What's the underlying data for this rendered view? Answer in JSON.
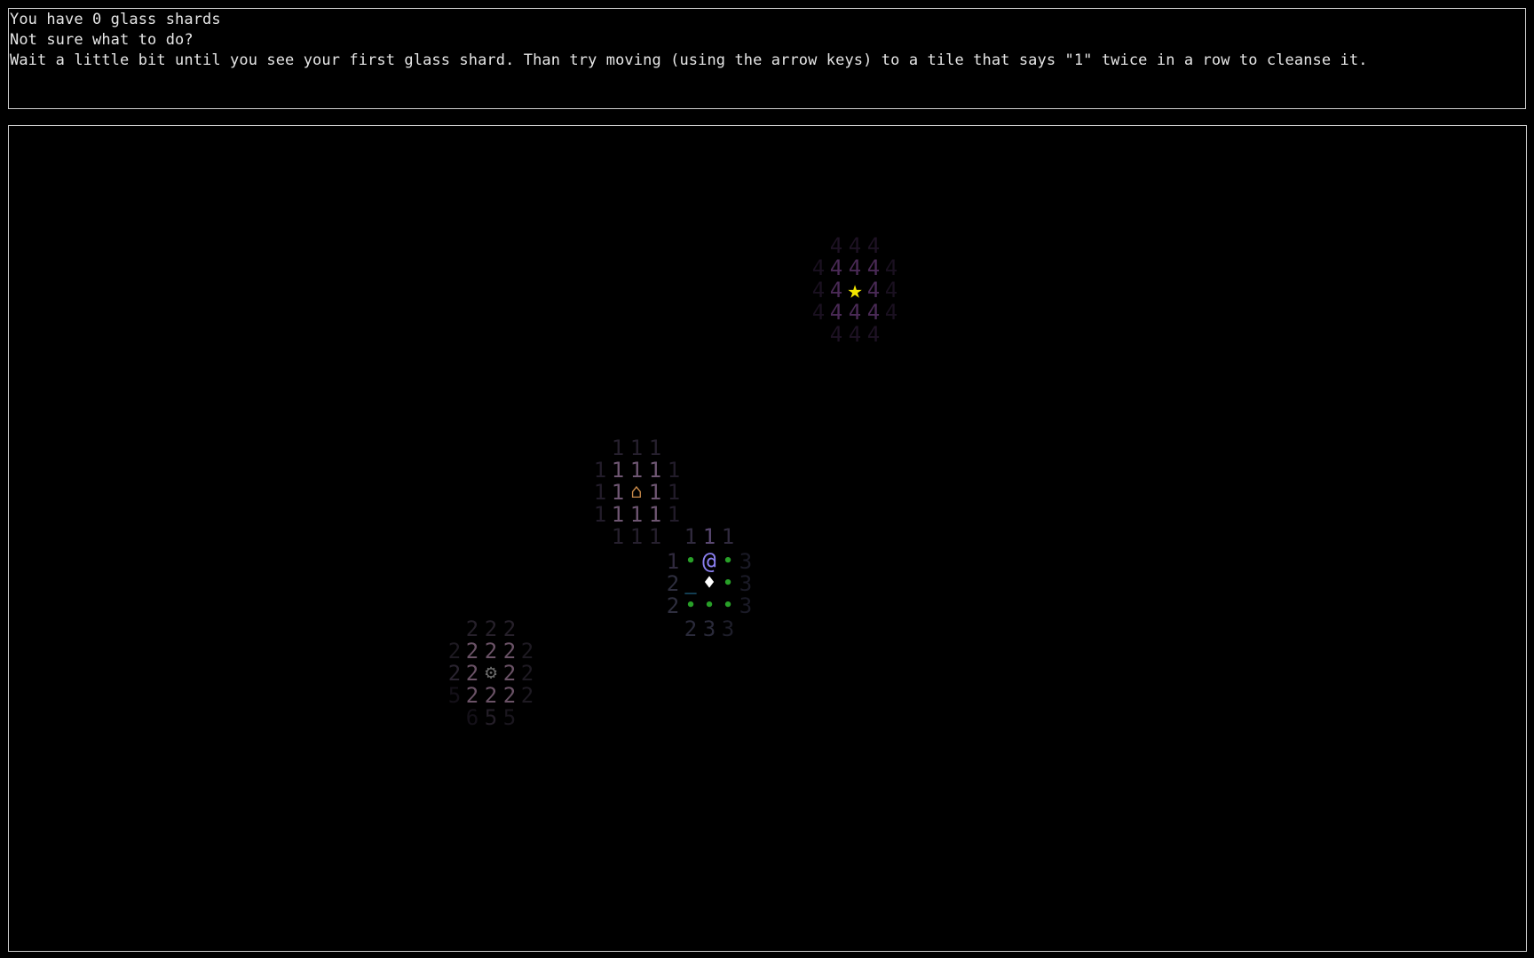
{
  "messages": {
    "shards_line": "You have 0 glass shards",
    "help_question": "Not sure what to do?",
    "help_text": "Wait a little bit until you see your first glass shard. Than try moving (using the arrow keys) to a tile that says \"1\" twice in a row to cleanse it."
  },
  "colors": {
    "background": "#000000",
    "border": "#cfcfcf",
    "text": "#e6e6e6",
    "player": "#8a7ff0",
    "shard": "#ffffff",
    "star": "#f2e600",
    "home": "#c98a4a",
    "gear": "#6a6a6a",
    "walkable_dot": "#28a028",
    "portal_line": "#2a8ab8"
  },
  "map": {
    "legend": {
      "player": "@",
      "glass_shard": "♦",
      "star": "★",
      "home": "⌂",
      "gear": "⚙",
      "walkable": "•",
      "portal": "_"
    },
    "tiles": [
      {
        "ch": "4",
        "c": "#1e1224"
      },
      {
        "ch": "4",
        "c": "#1e1224"
      },
      {
        "ch": "4",
        "c": "#1e1224"
      },
      {
        "ch": "4",
        "c": "#1a1020"
      },
      {
        "ch": "4",
        "c": "#4a2a56"
      },
      {
        "ch": "4",
        "c": "#4a2a56"
      },
      {
        "ch": "4",
        "c": "#4a2a56"
      },
      {
        "ch": "4",
        "c": "#1a1020"
      },
      {
        "ch": "4",
        "c": "#1a1020"
      },
      {
        "ch": "4",
        "c": "#4a2a56"
      },
      {
        "ch": "★",
        "c": "#f2e600"
      },
      {
        "ch": "4",
        "c": "#4a2a56"
      },
      {
        "ch": "4",
        "c": "#1a1020"
      },
      {
        "ch": "4",
        "c": "#1a1020"
      },
      {
        "ch": "4",
        "c": "#4a2a56"
      },
      {
        "ch": "4",
        "c": "#4a2a56"
      },
      {
        "ch": "4",
        "c": "#4a2a56"
      },
      {
        "ch": "4",
        "c": "#1a1020"
      },
      {
        "ch": "4",
        "c": "#1e1224"
      },
      {
        "ch": "4",
        "c": "#1e1224"
      },
      {
        "ch": "4",
        "c": "#1e1224"
      },
      {
        "ch": "1",
        "c": "#26202e"
      },
      {
        "ch": "1",
        "c": "#26202e"
      },
      {
        "ch": "1",
        "c": "#26202e"
      },
      {
        "ch": "1",
        "c": "#221c2a"
      },
      {
        "ch": "1",
        "c": "#6e5672"
      },
      {
        "ch": "1",
        "c": "#6e5672"
      },
      {
        "ch": "1",
        "c": "#6e5672"
      },
      {
        "ch": "1",
        "c": "#221c2a"
      },
      {
        "ch": "1",
        "c": "#221c2a"
      },
      {
        "ch": "1",
        "c": "#6e5672"
      },
      {
        "ch": "⌂",
        "c": "#c98a4a"
      },
      {
        "ch": "1",
        "c": "#6e5672"
      },
      {
        "ch": "1",
        "c": "#221c2a"
      },
      {
        "ch": "1",
        "c": "#221c2a"
      },
      {
        "ch": "1",
        "c": "#6e5672"
      },
      {
        "ch": "1",
        "c": "#6e5672"
      },
      {
        "ch": "1",
        "c": "#6e5672"
      },
      {
        "ch": "1",
        "c": "#221c2a"
      },
      {
        "ch": "1",
        "c": "#26202e"
      },
      {
        "ch": "1",
        "c": "#26202e"
      },
      {
        "ch": "1",
        "c": "#26202e"
      },
      {
        "ch": "1",
        "c": "#302a3e"
      },
      {
        "ch": "1",
        "c": "#5a4872"
      },
      {
        "ch": "1",
        "c": "#302a3e"
      },
      {
        "ch": "1",
        "c": "#302a3e"
      },
      {
        "ch": "•",
        "c": "#28a028"
      },
      {
        "ch": "@",
        "c": "#8a7ff0"
      },
      {
        "ch": "•",
        "c": "#28a028"
      },
      {
        "ch": "3",
        "c": "#1a1a26"
      },
      {
        "ch": "2",
        "c": "#2e2e3e"
      },
      {
        "ch": "_",
        "c": "#2a8ab8"
      },
      {
        "ch": "♦",
        "c": "#ffffff"
      },
      {
        "ch": "•",
        "c": "#28a028"
      },
      {
        "ch": "3",
        "c": "#1a1a26"
      },
      {
        "ch": "2",
        "c": "#2e2e3e"
      },
      {
        "ch": "•",
        "c": "#28a028"
      },
      {
        "ch": "•",
        "c": "#28a028"
      },
      {
        "ch": "•",
        "c": "#28a028"
      },
      {
        "ch": "3",
        "c": "#1a1a26"
      },
      {
        "ch": "2",
        "c": "#2a2a3a"
      },
      {
        "ch": "3",
        "c": "#2a2a3a"
      },
      {
        "ch": "3",
        "c": "#1e1e2a"
      },
      {
        "ch": "2",
        "c": "#26202a"
      },
      {
        "ch": "2",
        "c": "#26202a"
      },
      {
        "ch": "2",
        "c": "#26202a"
      },
      {
        "ch": "2",
        "c": "#1e1a22"
      },
      {
        "ch": "2",
        "c": "#6a5266"
      },
      {
        "ch": "2",
        "c": "#6a5266"
      },
      {
        "ch": "2",
        "c": "#6a5266"
      },
      {
        "ch": "2",
        "c": "#1e1a22"
      },
      {
        "ch": "2",
        "c": "#2a2430"
      },
      {
        "ch": "2",
        "c": "#6a5266"
      },
      {
        "ch": "⚙",
        "c": "#6a6a6a"
      },
      {
        "ch": "2",
        "c": "#6a5266"
      },
      {
        "ch": "2",
        "c": "#1e1a22"
      },
      {
        "ch": "5",
        "c": "#141018"
      },
      {
        "ch": "2",
        "c": "#6a5266"
      },
      {
        "ch": "2",
        "c": "#6a5266"
      },
      {
        "ch": "2",
        "c": "#6a5266"
      },
      {
        "ch": "2",
        "c": "#1e1a22"
      },
      {
        "ch": "6",
        "c": "#141018"
      },
      {
        "ch": "5",
        "c": "#241e28"
      },
      {
        "ch": "5",
        "c": "#1a161e"
      }
    ]
  }
}
